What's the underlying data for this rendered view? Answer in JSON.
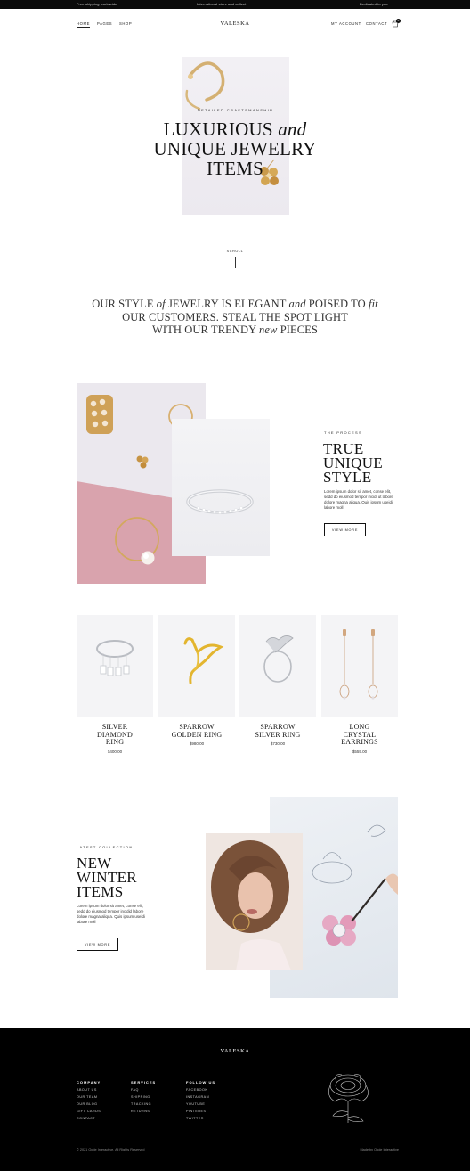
{
  "colors": {
    "accent_dark": "#0b0b0b",
    "footer_bg": "#000000",
    "card_bg": "#f4f4f6",
    "pink": "#d9a3ad",
    "gold": "#c9a060"
  },
  "topbar": {
    "left_text": "Free shipping worldwide",
    "center_text": "International store and collect",
    "right_text": "Dedicated to you"
  },
  "nav": {
    "left": [
      "HOME",
      "PAGES",
      "SHOP"
    ],
    "logo": "VALESKA",
    "right": [
      "MY ACCOUNT",
      "CONTACT"
    ],
    "cart_count": "0",
    "cart_icon": "shopping-bag-icon"
  },
  "hero": {
    "eyebrow": "DETAILED CRAFTSMANSHIP",
    "title_line1": "LUXURIOUS",
    "title_line1_italic": "and",
    "title_line2": "UNIQUE JEWELRY",
    "title_line3": "ITEMS",
    "scroll_label": "SCROLL"
  },
  "statement": {
    "p1": "OUR STYLE ",
    "i1": "of",
    "p2": " JEWELRY IS ELEGANT ",
    "i2": "and",
    "p3": " POISED TO ",
    "i3": "fit",
    "p4": "OUR CUSTOMERS. STEAL THE SPOT LIGHT",
    "p5": "WITH OUR TRENDY ",
    "i4": "new",
    "p6": " PIECES"
  },
  "process": {
    "eyebrow": "THE PROCESS",
    "title": [
      "TRUE",
      "UNIQUE",
      "STYLE"
    ],
    "text": "Lorem ipsum dolor sit amet, conse elit, sedd do eiusmod tempor incidi ut labore dolore magna aliqua. Quis ipsum useidi labore moll",
    "button": "VIEW MORE"
  },
  "products": [
    {
      "name": [
        "SILVER",
        "DIAMOND",
        "RING"
      ],
      "price": "$400.00"
    },
    {
      "name": [
        "SPARROW",
        "GOLDEN RING"
      ],
      "price": "$980.00"
    },
    {
      "name": [
        "SPARROW",
        "SILVER RING"
      ],
      "price": "$730.00"
    },
    {
      "name": [
        "LONG",
        "CRYSTAL",
        "EARRINGS"
      ],
      "price": "$555.00"
    }
  ],
  "collection": {
    "eyebrow": "LATEST COLLECTION",
    "title": [
      "NEW",
      "WINTER",
      "ITEMS"
    ],
    "text": "Lorem ipsum dolor sit amet, conse elit, sedd do eiusmod tempor incidid labore dolore magna aliqua. Quis ipsum useidi labore moll",
    "button": "VIEW MORE"
  },
  "footer": {
    "logo": "VALESKA",
    "columns": [
      {
        "heading": "COMPANY",
        "items": [
          "ABOUT US",
          "OUR TEAM",
          "OUR BLOG",
          "GIFT CARDS",
          "CONTACT"
        ]
      },
      {
        "heading": "SERVICES",
        "items": [
          "FAQ",
          "SHIPPING",
          "TRACKING",
          "RETURNS"
        ]
      },
      {
        "heading": "FOLLOW US",
        "items": [
          "FACEBOOK",
          "INSTAGRAM",
          "YOUTUBE",
          "PINTEREST",
          "TWITTER"
        ]
      }
    ],
    "copyright": "© 2021 Qode Interactive, All Rights Reserved",
    "made_by": "Made by Qode Interactive"
  }
}
